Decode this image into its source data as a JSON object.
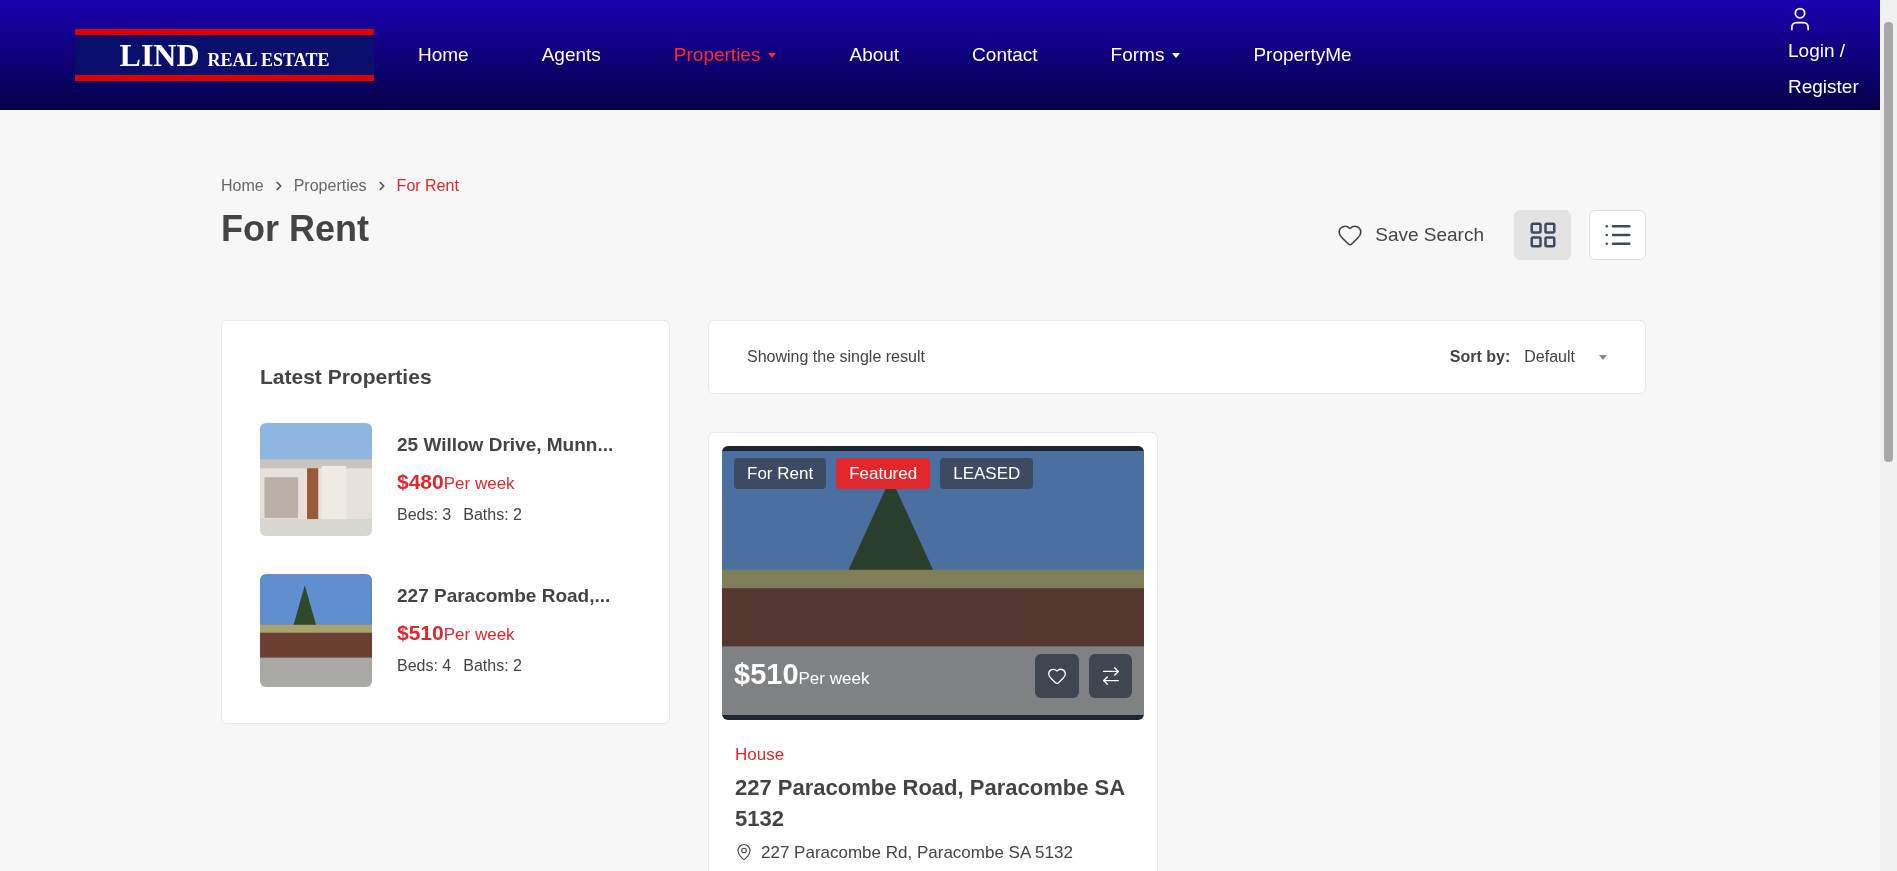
{
  "header": {
    "logo": {
      "main": "LIND",
      "sub": "REAL ESTATE"
    },
    "nav": [
      {
        "label": "Home",
        "selected": false,
        "dropdown": false
      },
      {
        "label": "Agents",
        "selected": false,
        "dropdown": false
      },
      {
        "label": "Properties",
        "selected": true,
        "dropdown": true
      },
      {
        "label": "About",
        "selected": false,
        "dropdown": false
      },
      {
        "label": "Contact",
        "selected": false,
        "dropdown": false
      },
      {
        "label": "Forms",
        "selected": false,
        "dropdown": true
      },
      {
        "label": "PropertyMe",
        "selected": false,
        "dropdown": false
      }
    ],
    "login": "Login / Register"
  },
  "breadcrumb": [
    {
      "label": "Home",
      "selected": false
    },
    {
      "label": "Properties",
      "selected": false
    },
    {
      "label": "For Rent",
      "selected": true
    }
  ],
  "page_title": "For Rent",
  "save_search": "Save Search",
  "views": [
    {
      "kind": "grid",
      "selected": true
    },
    {
      "kind": "list",
      "selected": false
    }
  ],
  "sidebar": {
    "title": "Latest Properties",
    "items": [
      {
        "title": "25 Willow Drive, Munn...",
        "price": "$480",
        "period": "Per week",
        "beds": "Beds: 3",
        "baths": "Baths: 2"
      },
      {
        "title": "227 Paracombe Road,...",
        "price": "$510",
        "period": "Per week",
        "beds": "Beds: 4",
        "baths": "Baths: 2"
      }
    ]
  },
  "results": {
    "summary": "Showing the single result",
    "sort_label": "Sort by:",
    "sort_value": "Default"
  },
  "listing": {
    "badges": [
      {
        "label": "For Rent",
        "color": "#3d4a63"
      },
      {
        "label": "Featured",
        "color": "#e2272d"
      },
      {
        "label": "LEASED",
        "color": "#3d4a63"
      }
    ],
    "price": "$510",
    "period": "Per week",
    "type": "House",
    "title": "227 Paracombe Road, Paracombe SA 5132",
    "address": "227 Paracombe Rd, Paracombe SA 5132"
  }
}
